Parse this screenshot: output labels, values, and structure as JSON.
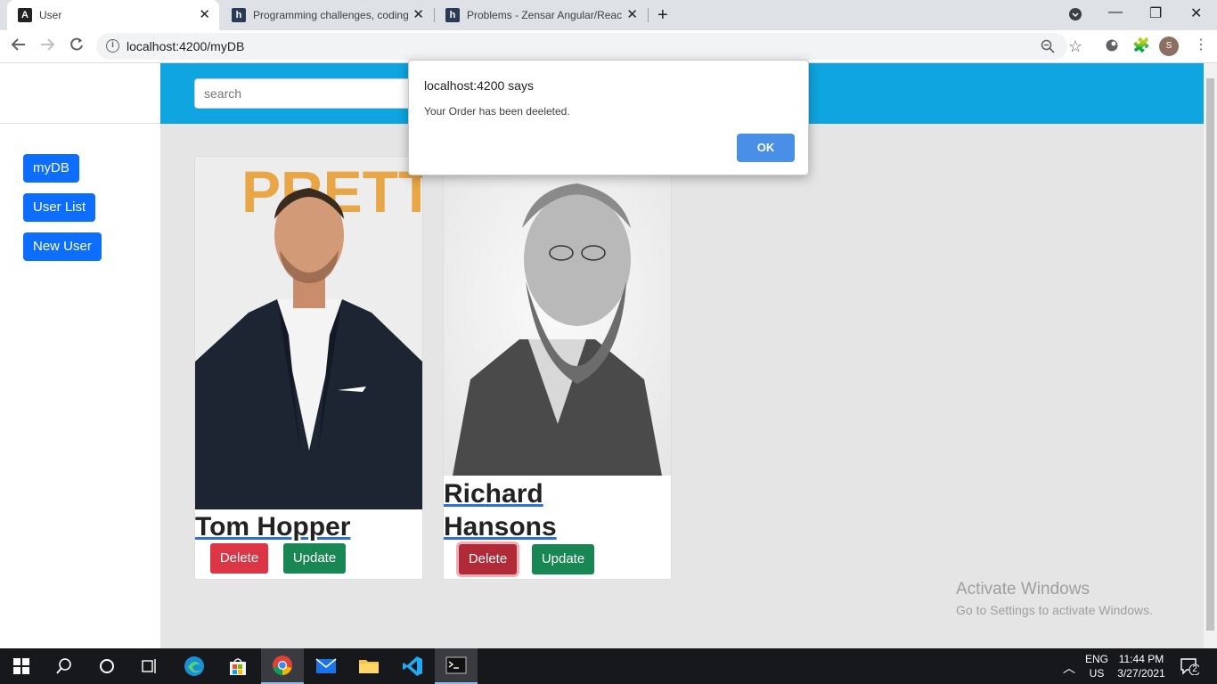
{
  "browser": {
    "tabs": [
      {
        "title": "User",
        "icon": "angular-icon",
        "active": true
      },
      {
        "title": "Programming challenges, coding",
        "icon": "hackerearth-icon",
        "active": false
      },
      {
        "title": "Problems - Zensar Angular/React",
        "icon": "hackerearth-icon",
        "active": false
      }
    ],
    "url": "localhost:4200/myDB",
    "profile_initial": "S"
  },
  "sidebar": {
    "items": [
      {
        "label": "myDB"
      },
      {
        "label": "User List"
      },
      {
        "label": "New User"
      }
    ]
  },
  "header": {
    "search_placeholder": "search"
  },
  "cards": [
    {
      "name": "Tom Hopper",
      "delete_label": "Delete",
      "update_label": "Update"
    },
    {
      "name": "Richard Hansons",
      "delete_label": "Delete",
      "update_label": "Update"
    }
  ],
  "dialog": {
    "title": "localhost:4200 says",
    "message": "Your Order has been deeleted.",
    "ok_label": "OK"
  },
  "watermark": {
    "title": "Activate Windows",
    "subtitle": "Go to Settings to activate Windows."
  },
  "taskbar": {
    "lang": "ENG",
    "region": "US",
    "time": "11:44 PM",
    "date": "3/27/2021",
    "notifications": "2"
  },
  "colors": {
    "primary": "#0d6efd",
    "danger": "#dc3545",
    "success": "#198754",
    "header": "#0ea5e0"
  }
}
